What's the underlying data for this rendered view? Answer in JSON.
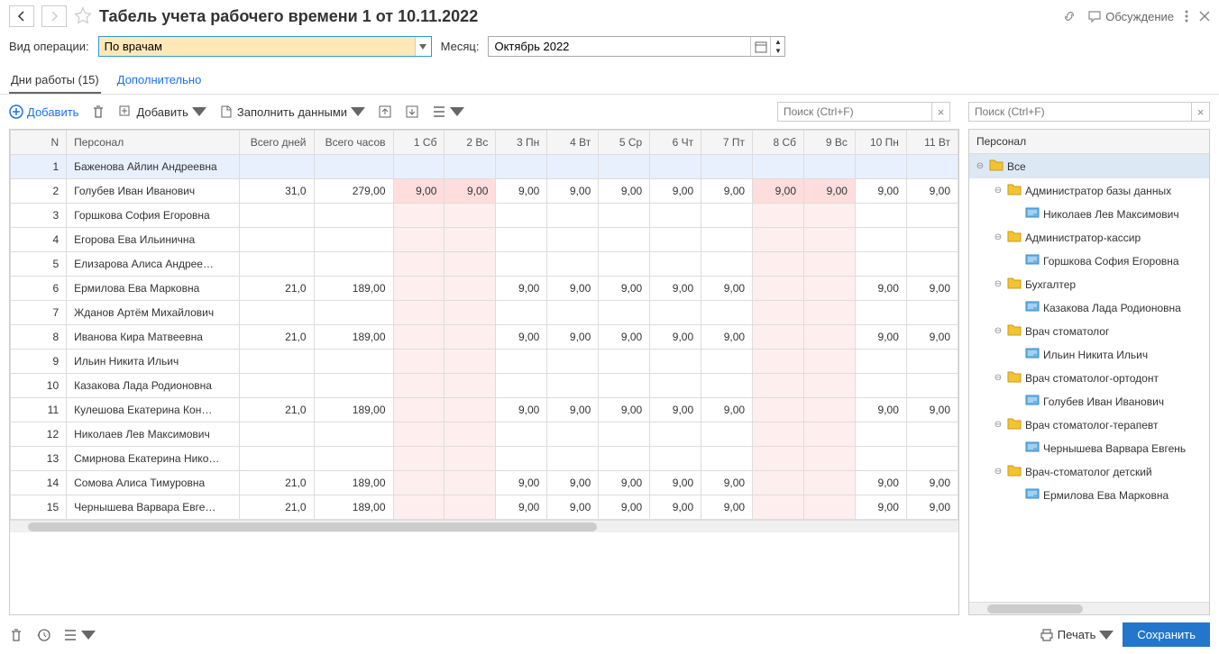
{
  "header": {
    "title": "Табель учета рабочего времени 1 от 10.11.2022",
    "discuss": "Обсуждение"
  },
  "params": {
    "operation_label": "Вид операции:",
    "operation_value": "По врачам",
    "month_label": "Месяц:",
    "month_value": "Октябрь 2022"
  },
  "tabs": {
    "workdays": "Дни работы (15)",
    "extra": "Дополнительно"
  },
  "toolbar": {
    "add": "Добавить",
    "add2": "Добавить",
    "fill": "Заполнить данными",
    "search_placeholder": "Поиск (Ctrl+F)"
  },
  "table": {
    "headers": {
      "n": "N",
      "name": "Персонал",
      "days": "Всего дней",
      "hours": "Всего часов",
      "d": [
        "1 Сб",
        "2 Вс",
        "3 Пн",
        "4 Вт",
        "5 Ср",
        "6 Чт",
        "7 Пт",
        "8 Сб",
        "9 Вс",
        "10 Пн",
        "11 Вт"
      ]
    },
    "rows": [
      {
        "n": "1",
        "name": "Баженова Айлин Андреевна",
        "days": "",
        "hours": "",
        "d": [
          "",
          "",
          "",
          "",
          "",
          "",
          "",
          "",
          "",
          "",
          ""
        ]
      },
      {
        "n": "2",
        "name": "Голубев Иван Иванович",
        "days": "31,0",
        "hours": "279,00",
        "d": [
          "9,00",
          "9,00",
          "9,00",
          "9,00",
          "9,00",
          "9,00",
          "9,00",
          "9,00",
          "9,00",
          "9,00",
          "9,00"
        ]
      },
      {
        "n": "3",
        "name": "Горшкова София Егоровна",
        "days": "",
        "hours": "",
        "d": [
          "",
          "",
          "",
          "",
          "",
          "",
          "",
          "",
          "",
          "",
          ""
        ]
      },
      {
        "n": "4",
        "name": "Егорова Ева Ильинична",
        "days": "",
        "hours": "",
        "d": [
          "",
          "",
          "",
          "",
          "",
          "",
          "",
          "",
          "",
          "",
          ""
        ]
      },
      {
        "n": "5",
        "name": "Елизарова Алиса Андрее…",
        "days": "",
        "hours": "",
        "d": [
          "",
          "",
          "",
          "",
          "",
          "",
          "",
          "",
          "",
          "",
          ""
        ]
      },
      {
        "n": "6",
        "name": "Ермилова Ева Марковна",
        "days": "21,0",
        "hours": "189,00",
        "d": [
          "",
          "",
          "9,00",
          "9,00",
          "9,00",
          "9,00",
          "9,00",
          "",
          "",
          "9,00",
          "9,00"
        ]
      },
      {
        "n": "7",
        "name": "Жданов Артём Михайлович",
        "days": "",
        "hours": "",
        "d": [
          "",
          "",
          "",
          "",
          "",
          "",
          "",
          "",
          "",
          "",
          ""
        ]
      },
      {
        "n": "8",
        "name": "Иванова Кира Матвеевна",
        "days": "21,0",
        "hours": "189,00",
        "d": [
          "",
          "",
          "9,00",
          "9,00",
          "9,00",
          "9,00",
          "9,00",
          "",
          "",
          "9,00",
          "9,00"
        ]
      },
      {
        "n": "9",
        "name": "Ильин Никита Ильич",
        "days": "",
        "hours": "",
        "d": [
          "",
          "",
          "",
          "",
          "",
          "",
          "",
          "",
          "",
          "",
          ""
        ]
      },
      {
        "n": "10",
        "name": "Казакова Лада Родионовна",
        "days": "",
        "hours": "",
        "d": [
          "",
          "",
          "",
          "",
          "",
          "",
          "",
          "",
          "",
          "",
          ""
        ]
      },
      {
        "n": "11",
        "name": "Кулешова Екатерина Кон…",
        "days": "21,0",
        "hours": "189,00",
        "d": [
          "",
          "",
          "9,00",
          "9,00",
          "9,00",
          "9,00",
          "9,00",
          "",
          "",
          "9,00",
          "9,00"
        ]
      },
      {
        "n": "12",
        "name": "Николаев Лев Максимович",
        "days": "",
        "hours": "",
        "d": [
          "",
          "",
          "",
          "",
          "",
          "",
          "",
          "",
          "",
          "",
          ""
        ]
      },
      {
        "n": "13",
        "name": "Смирнова Екатерина Нико…",
        "days": "",
        "hours": "",
        "d": [
          "",
          "",
          "",
          "",
          "",
          "",
          "",
          "",
          "",
          "",
          ""
        ]
      },
      {
        "n": "14",
        "name": "Сомова Алиса Тимуровна",
        "days": "21,0",
        "hours": "189,00",
        "d": [
          "",
          "",
          "9,00",
          "9,00",
          "9,00",
          "9,00",
          "9,00",
          "",
          "",
          "9,00",
          "9,00"
        ]
      },
      {
        "n": "15",
        "name": "Чернышева Варвара Евге…",
        "days": "21,0",
        "hours": "189,00",
        "d": [
          "",
          "",
          "9,00",
          "9,00",
          "9,00",
          "9,00",
          "9,00",
          "",
          "",
          "9,00",
          "9,00"
        ]
      }
    ]
  },
  "side": {
    "header": "Персонал",
    "search_placeholder": "Поиск (Ctrl+F)",
    "tree": [
      {
        "level": 0,
        "type": "folder",
        "open": true,
        "label": "Все",
        "selected": true
      },
      {
        "level": 1,
        "type": "folder",
        "open": true,
        "label": "Администратор базы данных"
      },
      {
        "level": 2,
        "type": "leaf",
        "label": "Николаев Лев Максимович"
      },
      {
        "level": 1,
        "type": "folder",
        "open": true,
        "label": "Администратор-кассир"
      },
      {
        "level": 2,
        "type": "leaf",
        "label": "Горшкова София Егоровна"
      },
      {
        "level": 1,
        "type": "folder",
        "open": true,
        "label": "Бухгалтер"
      },
      {
        "level": 2,
        "type": "leaf",
        "label": "Казакова Лада Родионовна"
      },
      {
        "level": 1,
        "type": "folder",
        "open": true,
        "label": "Врач стоматолог"
      },
      {
        "level": 2,
        "type": "leaf",
        "label": "Ильин Никита Ильич"
      },
      {
        "level": 1,
        "type": "folder",
        "open": true,
        "label": "Врач стоматолог-ортодонт"
      },
      {
        "level": 2,
        "type": "leaf",
        "label": "Голубев Иван Иванович"
      },
      {
        "level": 1,
        "type": "folder",
        "open": true,
        "label": "Врач стоматолог-терапевт"
      },
      {
        "level": 2,
        "type": "leaf",
        "label": "Чернышева Варвара Евгень"
      },
      {
        "level": 1,
        "type": "folder",
        "open": true,
        "label": "Врач-стоматолог детский"
      },
      {
        "level": 2,
        "type": "leaf",
        "label": "Ермилова Ева Марковна"
      }
    ]
  },
  "footer": {
    "print": "Печать",
    "save": "Сохранить"
  }
}
